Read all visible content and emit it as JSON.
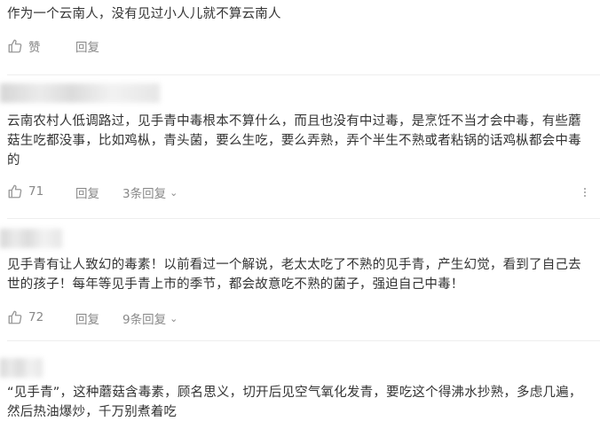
{
  "comments": [
    {
      "text": "作为一个云南人，没有见过小人儿就不算云南人",
      "like_label": "赞",
      "reply_label": "回复"
    },
    {
      "text": "云南农村人低调路过，见手青中毒根本不算什么，而且也没有中过毒，是烹饪不当才会中毒，有些蘑菇生吃都没事，比如鸡枞，青头菌，要么生吃，要么弄熟，弄个半生不熟或者粘锅的话鸡枞都会中毒的",
      "like_label": "71",
      "reply_label": "回复",
      "replies_label": "3条回复"
    },
    {
      "text": "见手青有让人致幻的毒素！以前看过一个解说，老太太吃了不熟的见手青，产生幻觉，看到了自己去世的孩子！每年等见手青上市的季节，都会故意吃不熟的菌子，强迫自己中毒！",
      "like_label": "72",
      "reply_label": "回复",
      "replies_label": "9条回复"
    },
    {
      "text": "“见手青”，这种蘑菇含毒素，顾名思义，切开后见空气氧化发青，要吃这个得沸水抄熟，多虑几遍，然后热油爆炒，千万别煮着吃"
    }
  ],
  "icons": {
    "like": "thumbs-up-icon",
    "replies_toggle": "chevron-down-icon",
    "more": "more-vertical-icon"
  },
  "colors": {
    "text": "#333333",
    "secondary": "#888888",
    "divider": "#eeeeee"
  }
}
